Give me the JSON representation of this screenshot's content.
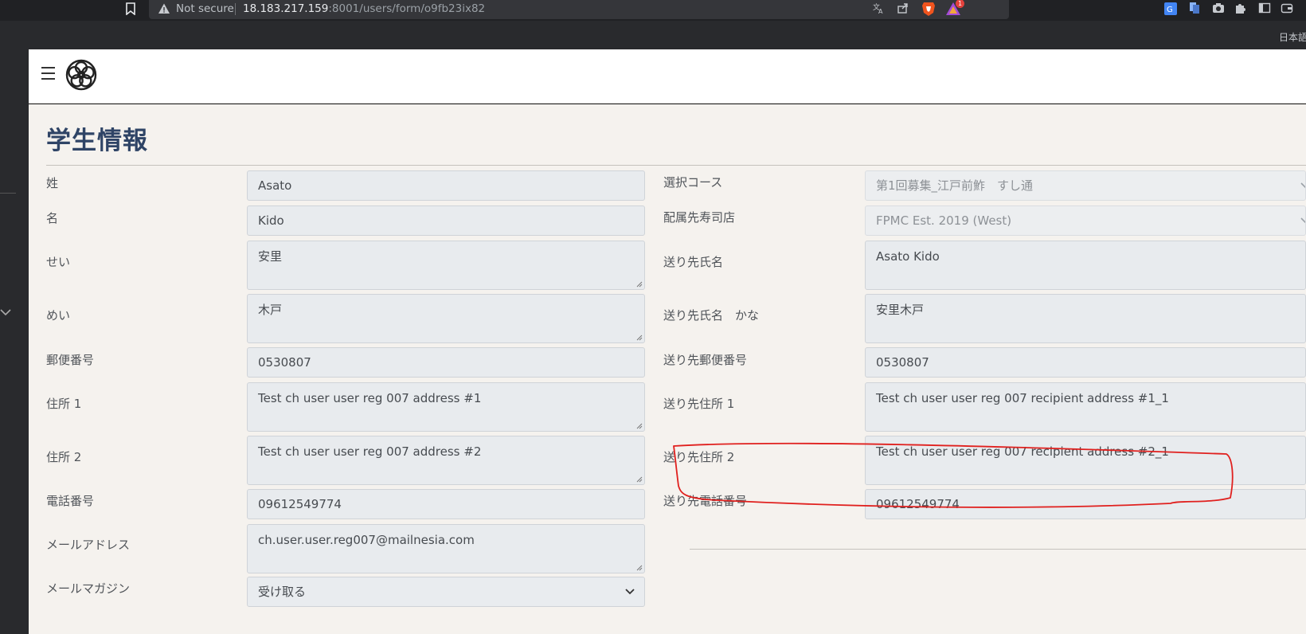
{
  "browser": {
    "security_label": "Not secure",
    "url_host": "18.183.217.159",
    "url_rest": ":8001/users/form/o9fb23ix82",
    "rewards_badge": "1",
    "language_tag": "日本語"
  },
  "page": {
    "title": "学生情報"
  },
  "left_form": [
    {
      "label": "姓",
      "value": "Asato"
    },
    {
      "label": "名",
      "value": "Kido"
    },
    {
      "label": "せい",
      "value": "安里"
    },
    {
      "label": "めい",
      "value": "木戸"
    },
    {
      "label": "郵便番号",
      "value": "0530807"
    },
    {
      "label": "住所 1",
      "value": "Test ch user user reg 007 address #1"
    },
    {
      "label": "住所 2",
      "value": "Test ch user user reg 007 address #2"
    },
    {
      "label": "電話番号",
      "value": "09612549774"
    },
    {
      "label": "メールアドレス",
      "value": "ch.user.user.reg007@mailnesia.com"
    },
    {
      "label": "メールマガジン",
      "value": "受け取る"
    }
  ],
  "right_form": [
    {
      "label": "選択コース",
      "value": "第1回募集_江戸前鮓　すし通"
    },
    {
      "label": "配属先寿司店",
      "value": "FPMC Est. 2019 (West)"
    },
    {
      "label": "送り先氏名",
      "value": "Asato Kido"
    },
    {
      "label": "送り先氏名　かな",
      "value": "安里木戸"
    },
    {
      "label": "送り先郵便番号",
      "value": "0530807"
    },
    {
      "label": "送り先住所 1",
      "value": "Test ch user user reg 007 recipient address #1_1"
    },
    {
      "label": "送り先住所 2",
      "value": "Test ch user user reg 007 recipient address #2_1"
    },
    {
      "label": "送り先電話番号",
      "value": "09612549774"
    }
  ],
  "colors": {
    "title": "#2f4466",
    "content_bg": "#f5f2ee",
    "field_bg": "#e8ebee",
    "annotation": "#e0201e"
  }
}
